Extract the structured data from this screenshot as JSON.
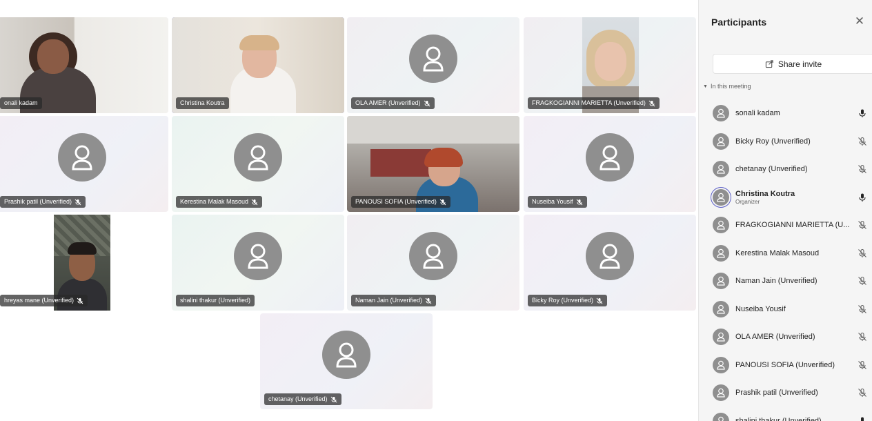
{
  "tiles": [
    {
      "name": "onali kadam",
      "muted": false,
      "video": true
    },
    {
      "name": "Christina Koutra",
      "muted": false,
      "video": true,
      "active": true
    },
    {
      "name": "OLA AMER (Unverified)",
      "muted": true,
      "video": false
    },
    {
      "name": "FRAGKOGIANNI MARIETTA (Unverified)",
      "muted": true,
      "video": true
    },
    {
      "name": "Prashik patil (Unverified)",
      "muted": true,
      "video": false
    },
    {
      "name": "Kerestina Malak Masoud",
      "muted": true,
      "video": false
    },
    {
      "name": "PANOUSI SOFIA (Unverified)",
      "muted": true,
      "video": true
    },
    {
      "name": "Nuseiba Yousif",
      "muted": true,
      "video": false
    },
    {
      "name": "hreyas mane (Unverified)",
      "muted": true,
      "video": true
    },
    {
      "name": "shalini thakur (Unverified)",
      "muted": false,
      "video": false
    },
    {
      "name": "Naman Jain (Unverified)",
      "muted": true,
      "video": false
    },
    {
      "name": "Bicky Roy (Unverified)",
      "muted": true,
      "video": false
    },
    {
      "name": "chetanay (Unverified)",
      "muted": true,
      "video": false
    }
  ],
  "panel": {
    "title": "Participants",
    "close_icon": "close-icon",
    "share_label": "Share invite",
    "section_label": "In this meeting",
    "participants": [
      {
        "name": "sonali kadam",
        "role": "",
        "muted": false
      },
      {
        "name": "Bicky Roy (Unverified)",
        "role": "",
        "muted": true
      },
      {
        "name": "chetanay (Unverified)",
        "role": "",
        "muted": true
      },
      {
        "name": "Christina Koutra",
        "role": "Organizer",
        "muted": false
      },
      {
        "name": "FRAGKOGIANNI MARIETTA (U...",
        "role": "",
        "muted": true
      },
      {
        "name": "Kerestina Malak Masoud",
        "role": "",
        "muted": true
      },
      {
        "name": "Naman Jain (Unverified)",
        "role": "",
        "muted": true
      },
      {
        "name": "Nuseiba Yousif",
        "role": "",
        "muted": true
      },
      {
        "name": "OLA AMER (Unverified)",
        "role": "",
        "muted": true
      },
      {
        "name": "PANOUSI SOFIA (Unverified)",
        "role": "",
        "muted": true
      },
      {
        "name": "Prashik patil (Unverified)",
        "role": "",
        "muted": true
      },
      {
        "name": "shalini thakur (Unverified)",
        "role": "",
        "muted": false
      }
    ]
  },
  "colors": {
    "accent": "#5b5fc7",
    "avatar": "#8f8f8f"
  }
}
